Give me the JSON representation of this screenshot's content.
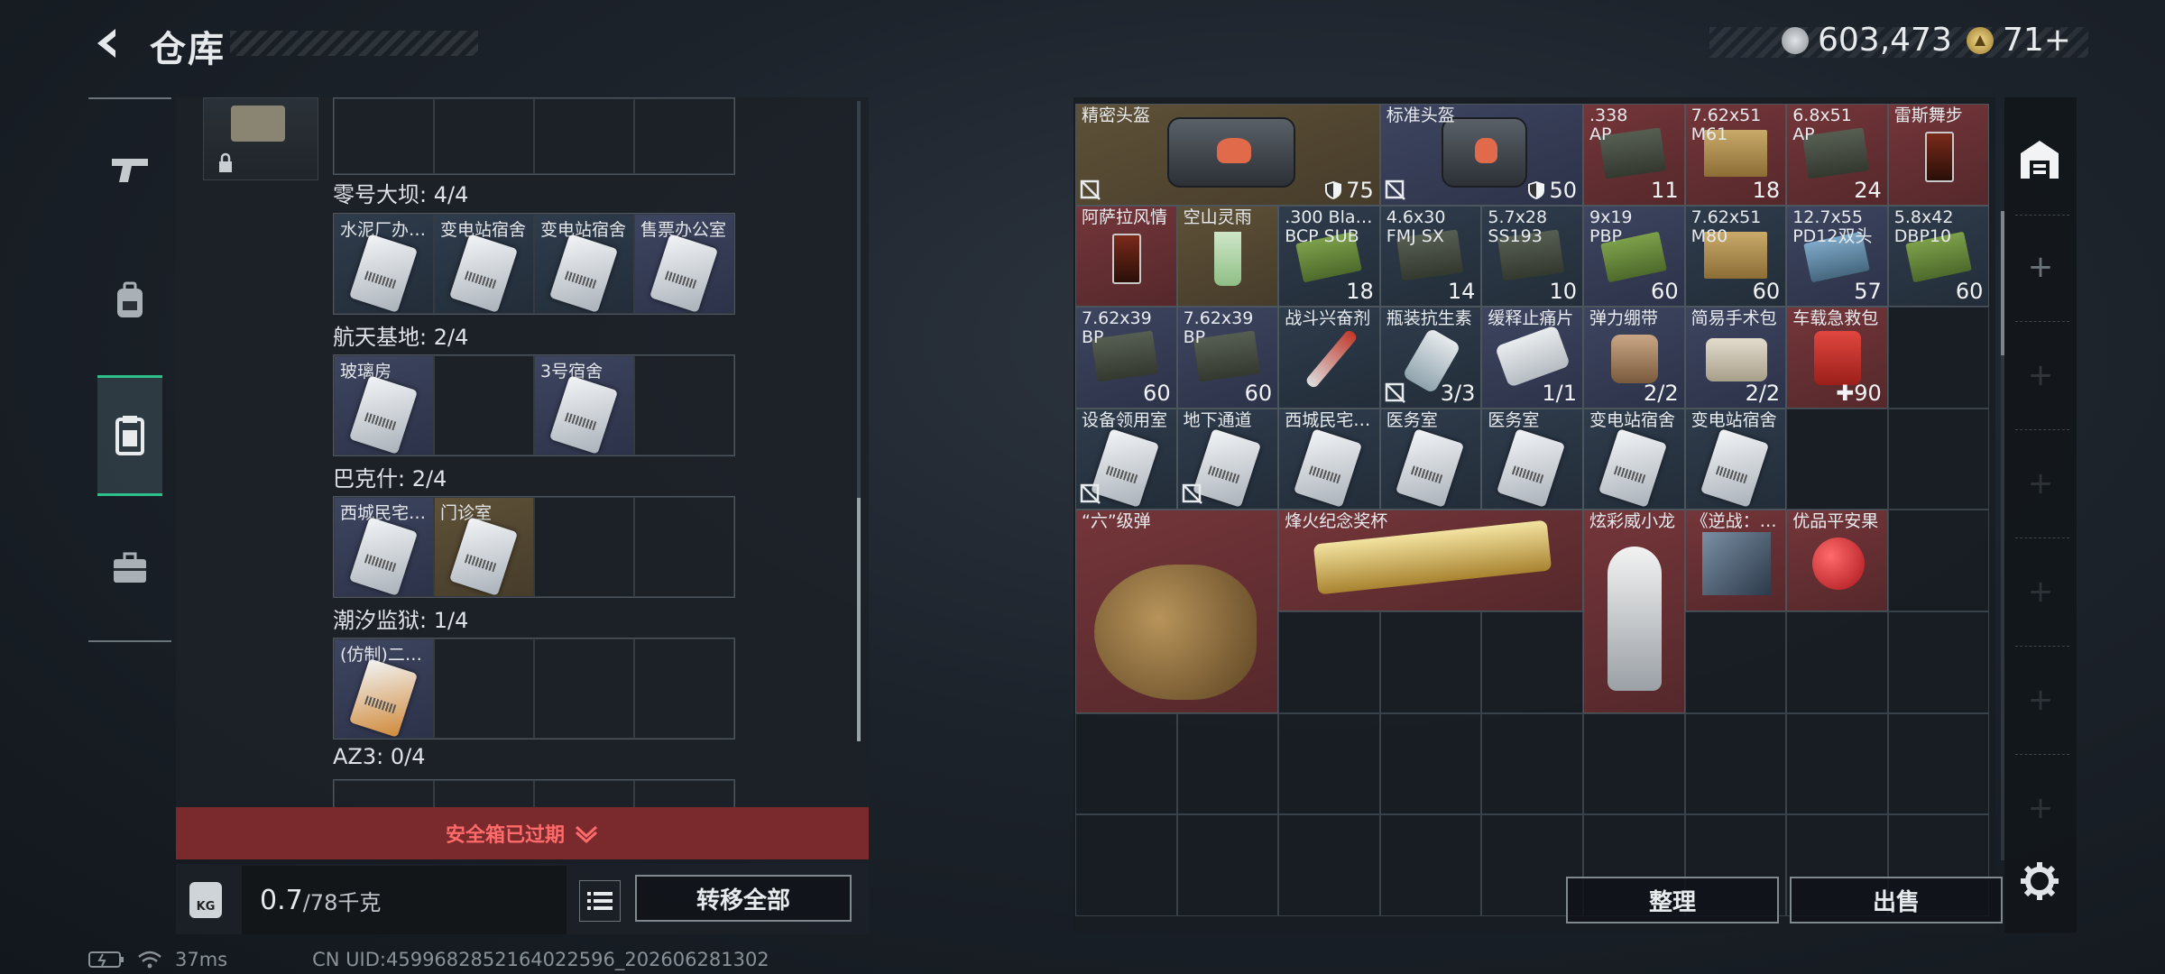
{
  "header": {
    "title": "仓库",
    "currency": [
      {
        "icon": "silver-coin-icon",
        "value": "603,473"
      },
      {
        "icon": "gold-triangle-coin-icon",
        "value": "71+"
      }
    ]
  },
  "sidenav": {
    "items": [
      {
        "name": "pistol-icon",
        "active": false
      },
      {
        "name": "backpack-icon",
        "active": false
      },
      {
        "name": "safe-box-icon",
        "active": true
      },
      {
        "name": "briefcase-icon",
        "active": false
      }
    ]
  },
  "left_panel": {
    "sections": [
      {
        "title": "零号大坝: 4/4",
        "cards": [
          "水泥厂办…",
          "变电站宿舍",
          "变电站宿舍",
          "售票办公室"
        ]
      },
      {
        "title": "航天基地: 2/4",
        "cards": [
          "玻璃房",
          "",
          "3号宿舍",
          ""
        ]
      },
      {
        "title": "巴克什: 2/4",
        "cards": [
          "西城民宅…",
          "门诊室",
          "",
          ""
        ]
      },
      {
        "title": "潮汐监狱: 1/4",
        "cards": [
          "(仿制)二…",
          "",
          "",
          ""
        ]
      },
      {
        "title": "AZ3: 0/4",
        "cards": []
      }
    ],
    "expired_text": "安全箱已过期",
    "weight_value": "0.7",
    "weight_max": "/78千克",
    "kg_label": "KG",
    "transfer_all": "转移全部"
  },
  "stash": {
    "items": [
      {
        "label": "精密头盔",
        "durability": "75",
        "locked": true
      },
      {
        "label": "标准头盔",
        "durability": "50",
        "locked": true
      },
      {
        "label": ".338\nAP",
        "count": "11"
      },
      {
        "label": "7.62x51\nM61",
        "count": "18"
      },
      {
        "label": "6.8x51\nAP",
        "count": "24"
      },
      {
        "label": "雷斯舞步",
        "count": ""
      },
      {
        "label": "阿萨拉风情",
        "count": ""
      },
      {
        "label": "空山灵雨",
        "count": ""
      },
      {
        "label": ".300 Bla…\nBCP SUB",
        "count": "18"
      },
      {
        "label": "4.6x30\nFMJ SX",
        "count": "14"
      },
      {
        "label": "5.7x28\nSS193",
        "count": "10"
      },
      {
        "label": "9x19\nPBP",
        "count": "60"
      },
      {
        "label": "7.62x51\nM80",
        "count": "60"
      },
      {
        "label": "12.7x55\nPD12双头",
        "count": "57"
      },
      {
        "label": "5.8x42\nDBP10",
        "count": "60"
      },
      {
        "label": "7.62x39\nBP",
        "count": "60"
      },
      {
        "label": "7.62x39\nBP",
        "count": "60"
      },
      {
        "label": "战斗兴奋剂",
        "count": ""
      },
      {
        "label": "瓶装抗生素",
        "count": "3/3",
        "locked": true
      },
      {
        "label": "缓释止痛片",
        "count": "1/1"
      },
      {
        "label": "弹力绷带",
        "count": "2/2"
      },
      {
        "label": "简易手术包",
        "count": "2/2"
      },
      {
        "label": "车载急救包",
        "count": "90"
      },
      {
        "label": "设备领用室",
        "locked": true
      },
      {
        "label": "地下通道",
        "locked": true
      },
      {
        "label": "西城民宅…"
      },
      {
        "label": "医务室"
      },
      {
        "label": "医务室"
      },
      {
        "label": "变电站宿舍"
      },
      {
        "label": "变电站宿舍"
      },
      {
        "label": "“六”级弹"
      },
      {
        "label": "烽火纪念奖杯"
      },
      {
        "label": "炫彩威小龙"
      },
      {
        "label": "《逆战：…"
      },
      {
        "label": "优品平安果"
      }
    ],
    "sort_button": "整理",
    "sell_button": "出售"
  },
  "status": {
    "ping": "37ms",
    "uid": "CN UID:4599682852164022596_202606281302"
  }
}
